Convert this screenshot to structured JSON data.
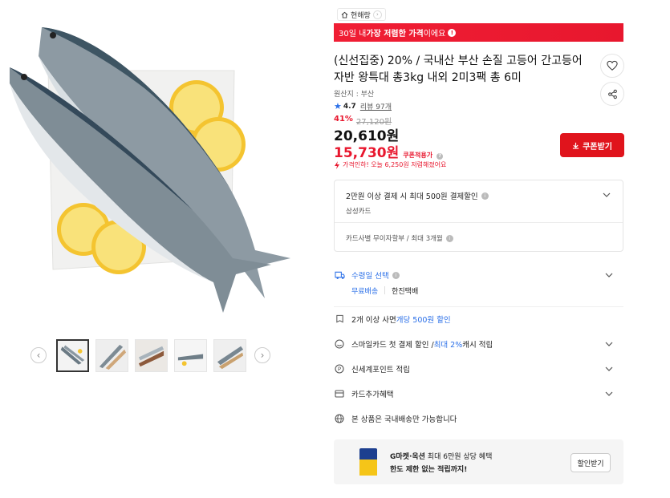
{
  "store": {
    "name": "현해랑"
  },
  "banner": {
    "prefix": "30일 내 ",
    "highlight": "가장 저렴한 가격",
    "suffix": "이에요"
  },
  "product": {
    "title": "(신선집중) 20% / 국내산 부산 손질 고등어 간고등어 자반 왕특대 총3kg 내외 2미3팩 총 6미",
    "origin": "원산지 : 부산",
    "rating": "4.7",
    "review_label": "리뷰 97개",
    "discount_pct": "41%",
    "original_price": "27,120원",
    "price": "20,610원",
    "coupon_price": "15,730원",
    "coupon_tag": "쿠폰적용가",
    "price_alert": "가격인하! 오늘 6,250원 저렴해졌어요",
    "coupon_button": "쿠폰받기"
  },
  "card_benefit": {
    "line1": "2만원 이상 결제 시 최대 500원 결제할인",
    "line2": "삼성카드",
    "line3": "카드사별 무이자할부 / 최대 3개월"
  },
  "shipping": {
    "label": "수령일 선택",
    "free": "무료배송",
    "carrier": "한진택배"
  },
  "rows": {
    "bulk_prefix": "2개 이상 사면 ",
    "bulk_highlight": "개당 500원 할인",
    "smile_prefix": "스마일카드 첫 결제 할인 / ",
    "smile_highlight": "최대 2%",
    "smile_suffix": " 캐시 적립",
    "shinsegae": "신세계포인트 적립",
    "card_extra": "카드추가혜택",
    "domestic": "본 상품은 국내배송만 가능합니다"
  },
  "promo": {
    "brand": "G마켓·옥션",
    "line1_rest": " 최대 6만원 상당 혜택",
    "line2": "한도 제한 없는 적립까지!",
    "button": "할인받기"
  },
  "colors": {
    "accent_red": "#e8172e",
    "accent_blue": "#2a6fe8"
  }
}
